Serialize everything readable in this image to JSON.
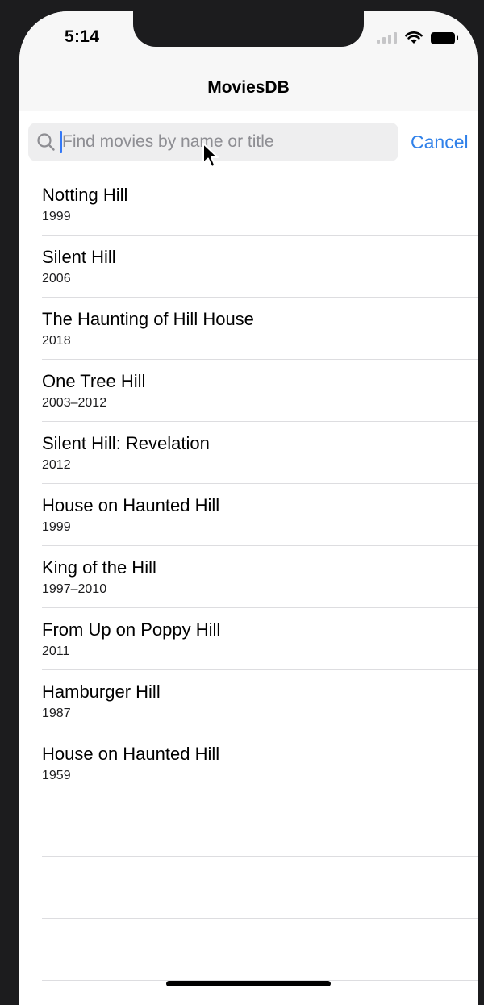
{
  "status_bar": {
    "time": "5:14",
    "icons": [
      "cellular-signal-icon",
      "wifi-icon",
      "battery-icon"
    ]
  },
  "nav": {
    "title": "MoviesDB"
  },
  "search": {
    "placeholder": "Find movies by name or title",
    "value": "",
    "cancel_label": "Cancel",
    "icon": "search-icon"
  },
  "results": [
    {
      "title": "Notting Hill",
      "year": "1999"
    },
    {
      "title": "Silent Hill",
      "year": "2006"
    },
    {
      "title": "The Haunting of Hill House",
      "year": "2018"
    },
    {
      "title": "One Tree Hill",
      "year": "2003–2012"
    },
    {
      "title": "Silent Hill: Revelation",
      "year": "2012"
    },
    {
      "title": "House on Haunted Hill",
      "year": "1999"
    },
    {
      "title": "King of the Hill",
      "year": "1997–2010"
    },
    {
      "title": "From Up on Poppy Hill",
      "year": "2011"
    },
    {
      "title": "Hamburger Hill",
      "year": "1987"
    },
    {
      "title": "House on Haunted Hill",
      "year": "1959"
    }
  ],
  "colors": {
    "accent": "#2f80e9",
    "caret": "#3478f6",
    "field_bg": "#eeeeef",
    "frame": "#1c1c1e"
  }
}
